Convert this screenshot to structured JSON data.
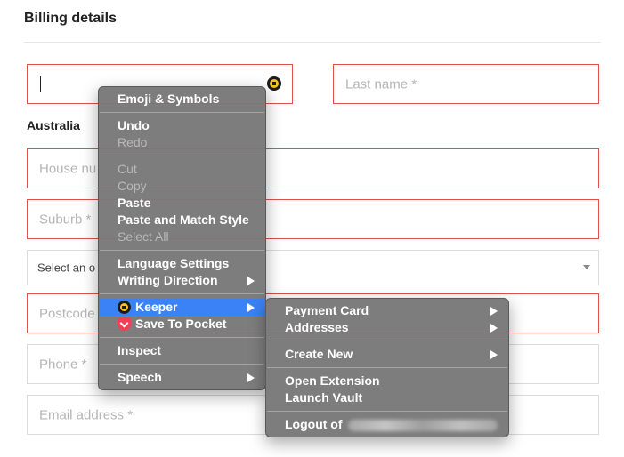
{
  "form": {
    "heading": "Billing details",
    "first_name_value": "",
    "last_name_placeholder": "Last name *",
    "country": "Australia",
    "house_placeholder": "House nu",
    "suburb_placeholder": "Suburb *",
    "select_text": "Select an o",
    "postcode_placeholder": "Postcode",
    "phone_placeholder": "Phone *",
    "email_placeholder": "Email address *"
  },
  "context_menu": {
    "items": [
      {
        "label": "Emoji & Symbols",
        "enabled": true
      },
      {
        "label": "Undo",
        "enabled": true
      },
      {
        "label": "Redo",
        "enabled": false
      },
      {
        "label": "Cut",
        "enabled": false
      },
      {
        "label": "Copy",
        "enabled": false
      },
      {
        "label": "Paste",
        "enabled": true
      },
      {
        "label": "Paste and Match Style",
        "enabled": true
      },
      {
        "label": "Select All",
        "enabled": false
      },
      {
        "label": "Language Settings",
        "enabled": true
      },
      {
        "label": "Writing Direction",
        "enabled": true,
        "submenu": true
      },
      {
        "label": "Keeper",
        "enabled": true,
        "submenu": true,
        "highlighted": true,
        "icon": "keeper-icon"
      },
      {
        "label": "Save To Pocket",
        "enabled": true,
        "icon": "pocket-icon"
      },
      {
        "label": "Inspect",
        "enabled": true
      },
      {
        "label": "Speech",
        "enabled": true,
        "submenu": true
      }
    ]
  },
  "keeper_submenu": {
    "items": [
      {
        "label": "Payment Card",
        "submenu": true
      },
      {
        "label": "Addresses",
        "submenu": true
      },
      {
        "label": "Create New",
        "submenu": true
      },
      {
        "label": "Open Extension"
      },
      {
        "label": "Launch Vault"
      },
      {
        "label": "Logout of"
      }
    ]
  },
  "colors": {
    "field_border_error": "#d9534f",
    "menu_bg": "#787878",
    "menu_highlight": "#3b82f6"
  }
}
